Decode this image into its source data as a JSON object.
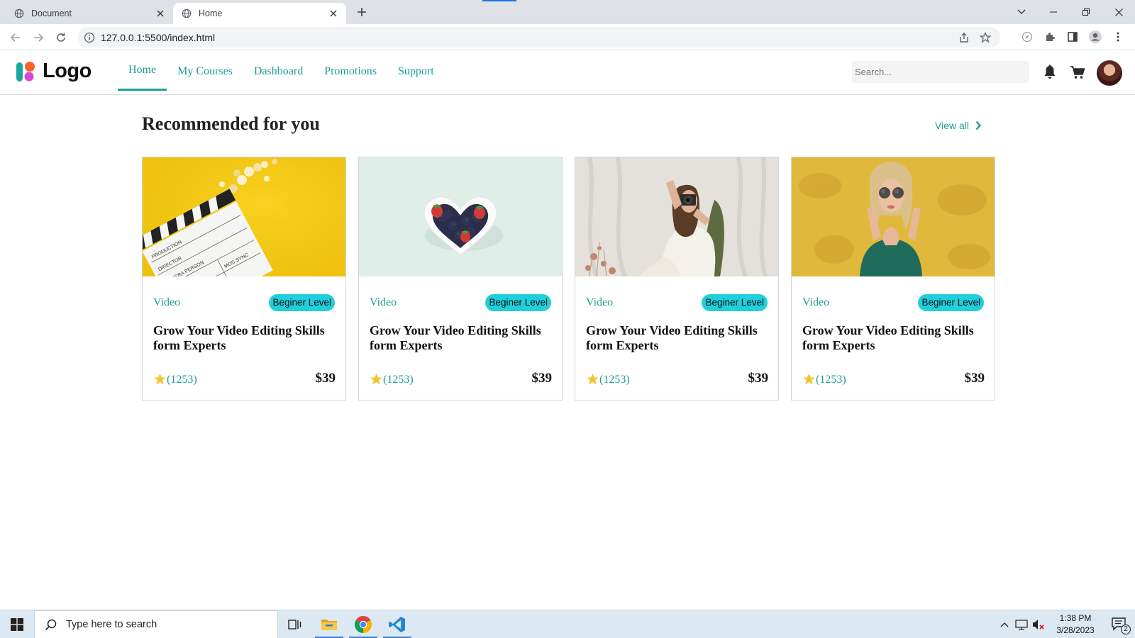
{
  "browser": {
    "tabs": [
      {
        "title": "Document",
        "active": false
      },
      {
        "title": "Home",
        "active": true
      }
    ],
    "url": "127.0.0.1:5500/index.html"
  },
  "site": {
    "logo_text": "Logo",
    "nav": [
      {
        "label": "Home",
        "active": true
      },
      {
        "label": "My Courses",
        "active": false
      },
      {
        "label": "Dashboard",
        "active": false
      },
      {
        "label": "Promotions",
        "active": false
      },
      {
        "label": "Support",
        "active": false
      }
    ],
    "search_placeholder": "Search...",
    "accent_color": "#1e9e96",
    "badge_color": "#1fcfdc"
  },
  "main": {
    "section_title": "Recommended for you",
    "view_all_label": "View all",
    "cards": [
      {
        "image": "clapperboard-popcorn-photo",
        "category": "Video",
        "level": "Beginer Level",
        "title": "Grow Your Video Editing Skills form Experts",
        "rating_count": "(1253)",
        "price": "$39"
      },
      {
        "image": "heart-bowl-berries-photo",
        "category": "Video",
        "level": "Beginer Level",
        "title": "Grow Your Video Editing Skills form Experts",
        "rating_count": "(1253)",
        "price": "$39"
      },
      {
        "image": "woman-camera-photo",
        "category": "Video",
        "level": "Beginer Level",
        "title": "Grow Your Video Editing Skills form Experts",
        "rating_count": "(1253)",
        "price": "$39"
      },
      {
        "image": "woman-sunglasses-yellow-photo",
        "category": "Video",
        "level": "Beginer Level",
        "title": "Grow Your Video Editing Skills form Experts",
        "rating_count": "(1253)",
        "price": "$39"
      }
    ]
  },
  "taskbar": {
    "search_placeholder": "Type here to search",
    "time": "1:38 PM",
    "date": "3/28/2023",
    "notification_count": "2"
  }
}
